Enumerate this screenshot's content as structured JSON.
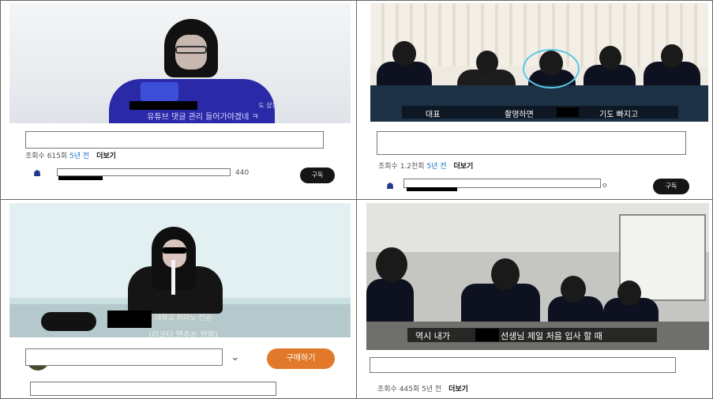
{
  "panels": {
    "top_left": {
      "caption_line1": "도 상동",
      "caption_line2": "유튜브 댓글 관리 들어가야겠네 ㅋ",
      "views": "조회수 615회",
      "age": "5년 전",
      "more": "더보기",
      "channel_count": "440",
      "subscribe": "구독"
    },
    "top_right": {
      "caption_left": "대표",
      "caption_mid": "촬영하면",
      "caption_right": "기도 빠지고",
      "views": "조회수 1.2천회",
      "age": "5년 전",
      "more": "더보기",
      "channel_count": "o",
      "subscribe": "구독"
    },
    "bottom_left": {
      "caption_line1": "대학교 피아노 전공",
      "caption_line2": "(리코더 연주는 안함)",
      "buy_button": "구매하기"
    },
    "bottom_right": {
      "caption_left": "역시 내가",
      "caption_right": "선생님 제일 처음 입사 할 때",
      "views": "조회수 445회",
      "age": "5년 전",
      "more": "더보기"
    }
  },
  "colors": {
    "accent_blue": "#1a73c8",
    "buy_orange": "#e2792a",
    "subscribe_black": "#151515"
  }
}
